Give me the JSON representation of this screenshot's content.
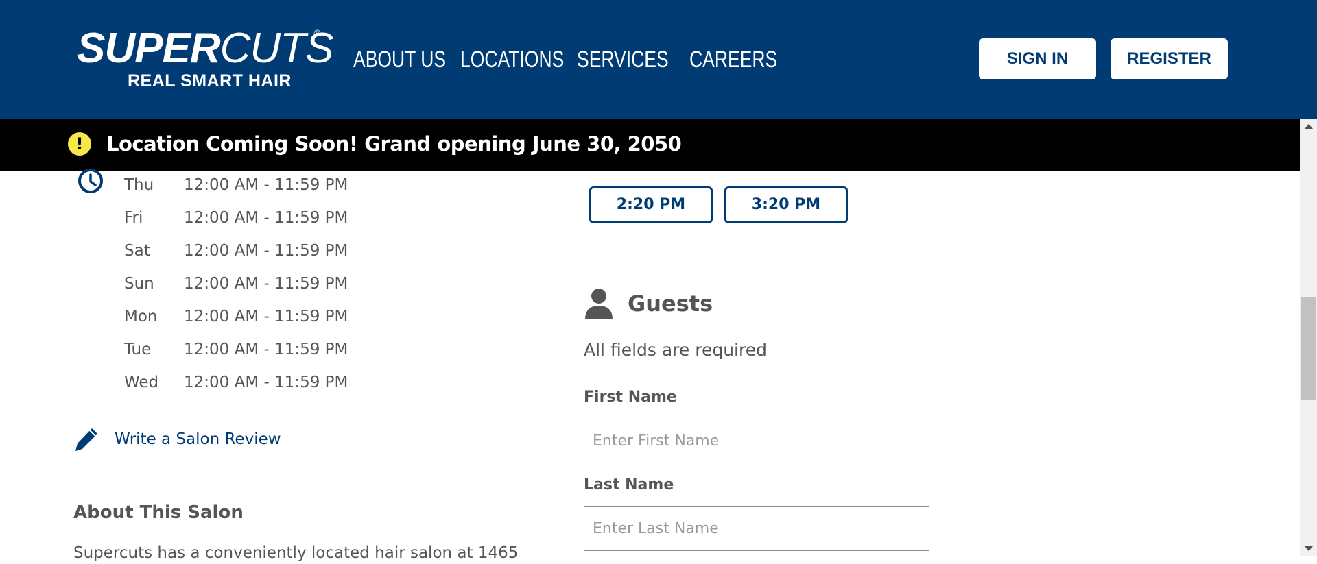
{
  "header": {
    "logo": {
      "name_bold": "SUPER",
      "name_light": "CUTS",
      "registered": "®",
      "tagline": "REAL SMART HAIR"
    },
    "nav": [
      {
        "label": "ABOUT US"
      },
      {
        "label": "LOCATIONS"
      },
      {
        "label": "SERVICES"
      },
      {
        "label": "CAREERS"
      }
    ],
    "sign_in_label": "SIGN IN",
    "register_label": "REGISTER"
  },
  "alert": {
    "icon": "exclamation-icon",
    "text": "Location Coming Soon! Grand opening June 30, 2050"
  },
  "hours": [
    {
      "day": "Thu",
      "time": "12:00 AM - 11:59 PM"
    },
    {
      "day": "Fri",
      "time": "12:00 AM - 11:59 PM"
    },
    {
      "day": "Sat",
      "time": "12:00 AM - 11:59 PM"
    },
    {
      "day": "Sun",
      "time": "12:00 AM - 11:59 PM"
    },
    {
      "day": "Mon",
      "time": "12:00 AM - 11:59 PM"
    },
    {
      "day": "Tue",
      "time": "12:00 AM - 11:59 PM"
    },
    {
      "day": "Wed",
      "time": "12:00 AM - 11:59 PM"
    }
  ],
  "review_link": "Write a Salon Review",
  "about": {
    "heading": "About This Salon",
    "text": "Supercuts has a conveniently located hair salon at 1465"
  },
  "time_slots": [
    {
      "label": "2:20 PM"
    },
    {
      "label": "3:20 PM"
    }
  ],
  "guests": {
    "title": "Guests",
    "required_note": "All fields are required",
    "first_name_label": "First Name",
    "first_name_placeholder": "Enter First Name",
    "first_name_value": "",
    "last_name_label": "Last Name",
    "last_name_placeholder": "Enter Last Name",
    "last_name_value": ""
  },
  "colors": {
    "brand_blue": "#003b73",
    "alert_bg": "#000000",
    "alert_icon": "#f7e84a",
    "text_gray": "#555555"
  }
}
